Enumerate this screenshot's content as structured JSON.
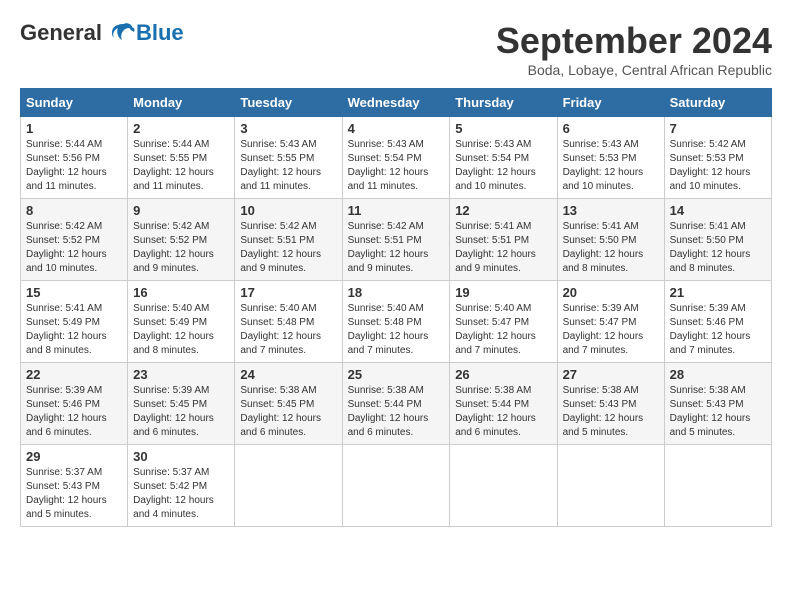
{
  "header": {
    "logo_general": "General",
    "logo_blue": "Blue",
    "month_title": "September 2024",
    "subtitle": "Boda, Lobaye, Central African Republic"
  },
  "days_of_week": [
    "Sunday",
    "Monday",
    "Tuesday",
    "Wednesday",
    "Thursday",
    "Friday",
    "Saturday"
  ],
  "weeks": [
    [
      {
        "day": "1",
        "sunrise": "5:44 AM",
        "sunset": "5:56 PM",
        "daylight": "12 hours and 11 minutes."
      },
      {
        "day": "2",
        "sunrise": "5:44 AM",
        "sunset": "5:55 PM",
        "daylight": "12 hours and 11 minutes."
      },
      {
        "day": "3",
        "sunrise": "5:43 AM",
        "sunset": "5:55 PM",
        "daylight": "12 hours and 11 minutes."
      },
      {
        "day": "4",
        "sunrise": "5:43 AM",
        "sunset": "5:54 PM",
        "daylight": "12 hours and 11 minutes."
      },
      {
        "day": "5",
        "sunrise": "5:43 AM",
        "sunset": "5:54 PM",
        "daylight": "12 hours and 10 minutes."
      },
      {
        "day": "6",
        "sunrise": "5:43 AM",
        "sunset": "5:53 PM",
        "daylight": "12 hours and 10 minutes."
      },
      {
        "day": "7",
        "sunrise": "5:42 AM",
        "sunset": "5:53 PM",
        "daylight": "12 hours and 10 minutes."
      }
    ],
    [
      {
        "day": "8",
        "sunrise": "5:42 AM",
        "sunset": "5:52 PM",
        "daylight": "12 hours and 10 minutes."
      },
      {
        "day": "9",
        "sunrise": "5:42 AM",
        "sunset": "5:52 PM",
        "daylight": "12 hours and 9 minutes."
      },
      {
        "day": "10",
        "sunrise": "5:42 AM",
        "sunset": "5:51 PM",
        "daylight": "12 hours and 9 minutes."
      },
      {
        "day": "11",
        "sunrise": "5:42 AM",
        "sunset": "5:51 PM",
        "daylight": "12 hours and 9 minutes."
      },
      {
        "day": "12",
        "sunrise": "5:41 AM",
        "sunset": "5:51 PM",
        "daylight": "12 hours and 9 minutes."
      },
      {
        "day": "13",
        "sunrise": "5:41 AM",
        "sunset": "5:50 PM",
        "daylight": "12 hours and 8 minutes."
      },
      {
        "day": "14",
        "sunrise": "5:41 AM",
        "sunset": "5:50 PM",
        "daylight": "12 hours and 8 minutes."
      }
    ],
    [
      {
        "day": "15",
        "sunrise": "5:41 AM",
        "sunset": "5:49 PM",
        "daylight": "12 hours and 8 minutes."
      },
      {
        "day": "16",
        "sunrise": "5:40 AM",
        "sunset": "5:49 PM",
        "daylight": "12 hours and 8 minutes."
      },
      {
        "day": "17",
        "sunrise": "5:40 AM",
        "sunset": "5:48 PM",
        "daylight": "12 hours and 7 minutes."
      },
      {
        "day": "18",
        "sunrise": "5:40 AM",
        "sunset": "5:48 PM",
        "daylight": "12 hours and 7 minutes."
      },
      {
        "day": "19",
        "sunrise": "5:40 AM",
        "sunset": "5:47 PM",
        "daylight": "12 hours and 7 minutes."
      },
      {
        "day": "20",
        "sunrise": "5:39 AM",
        "sunset": "5:47 PM",
        "daylight": "12 hours and 7 minutes."
      },
      {
        "day": "21",
        "sunrise": "5:39 AM",
        "sunset": "5:46 PM",
        "daylight": "12 hours and 7 minutes."
      }
    ],
    [
      {
        "day": "22",
        "sunrise": "5:39 AM",
        "sunset": "5:46 PM",
        "daylight": "12 hours and 6 minutes."
      },
      {
        "day": "23",
        "sunrise": "5:39 AM",
        "sunset": "5:45 PM",
        "daylight": "12 hours and 6 minutes."
      },
      {
        "day": "24",
        "sunrise": "5:38 AM",
        "sunset": "5:45 PM",
        "daylight": "12 hours and 6 minutes."
      },
      {
        "day": "25",
        "sunrise": "5:38 AM",
        "sunset": "5:44 PM",
        "daylight": "12 hours and 6 minutes."
      },
      {
        "day": "26",
        "sunrise": "5:38 AM",
        "sunset": "5:44 PM",
        "daylight": "12 hours and 6 minutes."
      },
      {
        "day": "27",
        "sunrise": "5:38 AM",
        "sunset": "5:43 PM",
        "daylight": "12 hours and 5 minutes."
      },
      {
        "day": "28",
        "sunrise": "5:38 AM",
        "sunset": "5:43 PM",
        "daylight": "12 hours and 5 minutes."
      }
    ],
    [
      {
        "day": "29",
        "sunrise": "5:37 AM",
        "sunset": "5:43 PM",
        "daylight": "12 hours and 5 minutes."
      },
      {
        "day": "30",
        "sunrise": "5:37 AM",
        "sunset": "5:42 PM",
        "daylight": "12 hours and 4 minutes."
      },
      null,
      null,
      null,
      null,
      null
    ]
  ],
  "labels": {
    "sunrise": "Sunrise:",
    "sunset": "Sunset:",
    "daylight": "Daylight:"
  }
}
